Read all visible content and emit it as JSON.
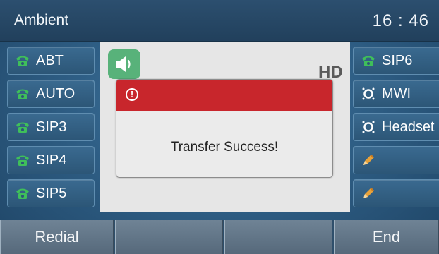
{
  "title_bar": {
    "title": "Ambient",
    "clock": "16 : 46"
  },
  "left_keys": [
    {
      "label": "ABT",
      "icon": "phone-icon"
    },
    {
      "label": "AUTO",
      "icon": "phone-icon"
    },
    {
      "label": "SIP3",
      "icon": "phone-icon"
    },
    {
      "label": "SIP4",
      "icon": "phone-icon"
    },
    {
      "label": "SIP5",
      "icon": "phone-icon"
    }
  ],
  "right_keys": [
    {
      "label": "SIP6",
      "icon": "phone-icon"
    },
    {
      "label": "MWI",
      "icon": "blf-icon"
    },
    {
      "label": "Headset",
      "icon": "blf-icon"
    },
    {
      "label": "",
      "icon": "pencil-icon"
    },
    {
      "label": "",
      "icon": "pencil-icon"
    }
  ],
  "call_panel": {
    "hd_label": "HD"
  },
  "dialog": {
    "message": "Transfer Success!"
  },
  "softkeys": [
    "Redial",
    "",
    "",
    "End"
  ],
  "colors": {
    "dialog_header": "#c8262c",
    "phone_icon": "#3fbf5a",
    "speaker_badge": "#58b27a",
    "pencil_icon": "#e8a23a"
  }
}
